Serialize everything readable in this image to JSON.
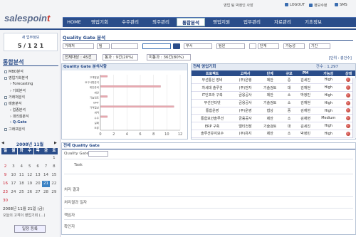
{
  "header": {
    "logo_main": "salespoin",
    "logo_accent": "t",
    "user_info": "영업 팀 박정인 사장",
    "links": [
      {
        "label": "LOGOUT",
        "icon": "logout-icon"
      },
      {
        "label": "정보수정",
        "icon": "user-edit-icon"
      },
      {
        "label": "SMS",
        "icon": "sms-icon"
      }
    ],
    "menu": [
      "HOME",
      "영업기회",
      "수주관리",
      "외주관리",
      "통합분석",
      "영업지원",
      "업무관리",
      "자료관리",
      "기초정보"
    ],
    "active_menu": "통합분석"
  },
  "sidebar": {
    "login_title": "새 업무정보",
    "login_user": "5 / 1 2 1",
    "section_title": "통합분석",
    "tree": [
      {
        "label": "MBO분석",
        "level": 0
      },
      {
        "label": "영업기회분석",
        "level": 0
      },
      {
        "label": "Forecasting",
        "level": 1
      },
      {
        "label": "기회분석",
        "level": 1
      },
      {
        "label": "거래처분석",
        "level": 0
      },
      {
        "label": "매출분석",
        "level": 0
      },
      {
        "label": "업종분석",
        "level": 1
      },
      {
        "label": "대리점분석",
        "level": 1
      },
      {
        "label": "Q-Gate",
        "level": 1
      },
      {
        "label": "그래프분석",
        "level": 0
      }
    ],
    "calendar": {
      "title": "2008년 11월",
      "weekdays": [
        "일",
        "월",
        "화",
        "수",
        "목",
        "금",
        "토"
      ],
      "rows": [
        [
          "",
          "",
          "",
          "",
          "",
          "",
          "1"
        ],
        [
          "2",
          "3",
          "4",
          "5",
          "6",
          "7",
          "8"
        ],
        [
          "9",
          "10",
          "11",
          "12",
          "13",
          "14",
          "15"
        ],
        [
          "16",
          "17",
          "18",
          "19",
          "20",
          "21",
          "22"
        ],
        [
          "23",
          "24",
          "25",
          "26",
          "27",
          "28",
          "29"
        ],
        [
          "30",
          "",
          "",
          "",
          "",
          "",
          ""
        ]
      ],
      "today": "21",
      "today_text": "2008년 11월 21일 (금)"
    },
    "footer_text": "오늘의 고객이 영업기회 (...)",
    "footer_button": "일정 등록"
  },
  "main": {
    "page_title": "Quality Gate 분석",
    "filters": [
      "거래처",
      "팀",
      "",
      "부서",
      "팀원",
      "",
      "단계",
      "가능성",
      "기간"
    ],
    "summary": [
      {
        "label": "전체대상 : 45건"
      },
      {
        "label": "통과 : 9건(20%)"
      },
      {
        "label": "미통과 : 36건(80%)"
      }
    ],
    "top_right": "[단위 : 총건수]",
    "chart_title": "Quality Gate 분석사항",
    "table_title": "전체 영업기회",
    "table_count": "건수 : 1,297",
    "table_cols": [
      "프로젝트",
      "고객사",
      "단계",
      "규모",
      "PM",
      "가능성",
      "상태"
    ],
    "table_rows": [
      [
        "무선통신 장비",
        "(주)은행",
        "제안",
        "중",
        "김세진",
        "High",
        ""
      ],
      [
        "차세대 솔루션",
        "(주)전자",
        "기술검토",
        "대",
        "김재현",
        "High",
        ""
      ],
      [
        "IT인프라 구축",
        "금융공사",
        "제안",
        "소",
        "박정민",
        "High",
        ""
      ],
      [
        "무선인터넷",
        "금융공사",
        "기술검토",
        "소",
        "김재현",
        "High",
        ""
      ],
      [
        "통합운영",
        "(주)운영",
        "협상",
        "중",
        "김재현",
        "High",
        ""
      ],
      [
        "통합보안솔루션",
        "금융공사",
        "제안",
        "소",
        "김재현",
        "Medium",
        ""
      ],
      [
        "ERP 구축",
        "엘티전장",
        "기술검토",
        "대",
        "김세진",
        "High",
        ""
      ],
      [
        "솔루션유지보수",
        "(주)유지",
        "제안",
        "소",
        "박정민",
        "High",
        ""
      ]
    ],
    "bottom_title": "전체 Quality Gate",
    "bottom_rows": [
      "Quality Gate",
      "Task",
      "처리 결과",
      "처리결과 일자",
      "책임자",
      "확인자"
    ]
  },
  "chart_data": {
    "type": "bar",
    "orientation": "horizontal",
    "title": "Quality Gate 분석사항",
    "categories": [
      "고객발굴",
      "요구사항분석",
      "제안준비",
      "제안",
      "기술검토",
      "BMT",
      "가격협상",
      "계약",
      "수주",
      "실패",
      "보류"
    ],
    "series": [
      {
        "name": "미통과",
        "values": [
          1,
          0,
          9,
          0,
          1,
          0,
          11,
          0,
          1,
          0,
          0
        ]
      },
      {
        "name": "통과",
        "values": [
          0,
          0,
          0,
          0,
          0,
          0,
          0,
          0,
          0,
          0,
          0
        ]
      }
    ],
    "xlim": [
      0,
      12
    ],
    "xticks": [
      0,
      2,
      4,
      6,
      8,
      10,
      12
    ],
    "colors": {
      "미통과": "#e8a9b0",
      "통과": "#c9a0a8"
    }
  }
}
